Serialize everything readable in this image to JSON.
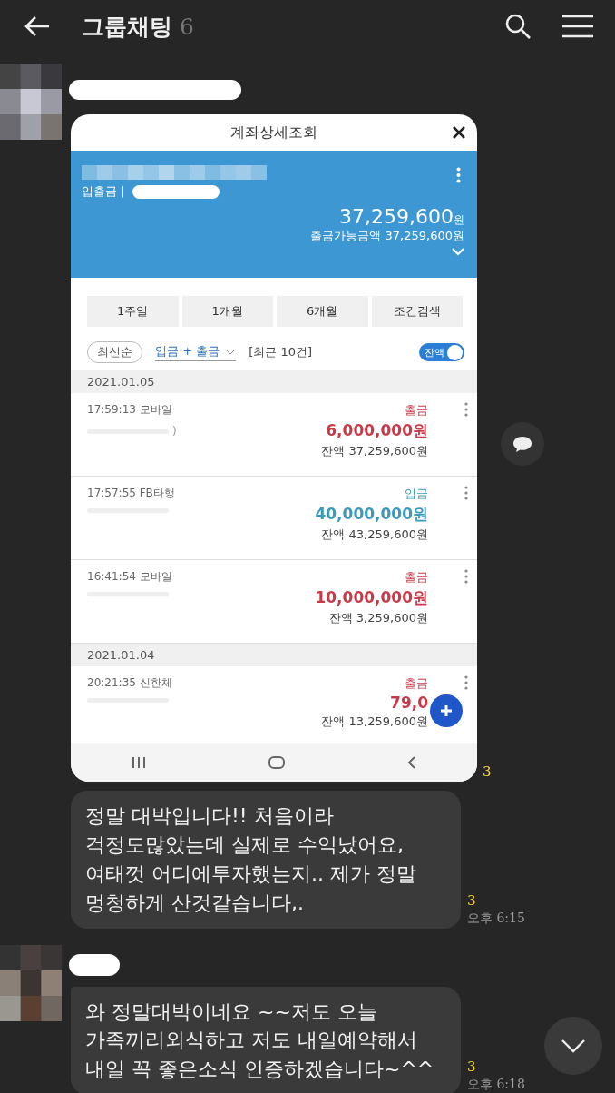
{
  "header": {
    "title": "그룹채팅",
    "member_count": "6"
  },
  "messages": [
    {
      "kind": "image",
      "read_count": "3",
      "screen": {
        "title": "계좌상세조회",
        "account_label": "입출금 |",
        "balance": "37,259,600",
        "balance_unit": "원",
        "available": "출금가능금액 37,259,600원",
        "periods": [
          {
            "label": "1주일"
          },
          {
            "label": "1개월"
          },
          {
            "label": "6개월"
          },
          {
            "label": "조건검색"
          }
        ],
        "sort": "최신순",
        "filter": "입금 + 출금",
        "recent": "[최근 10건]",
        "toggle": {
          "label": "잔액",
          "on": true
        },
        "groups": [
          {
            "date": "2021.01.05",
            "transactions": [
              {
                "time_source": "17:59:13 모바일",
                "memo": ")",
                "type": "출금",
                "kind": "withdrawal",
                "amount": "6,000,000원",
                "balance": "잔액 37,259,600원"
              },
              {
                "time_source": "17:57:55 FB타행",
                "type": "입금",
                "kind": "deposit",
                "amount": "40,000,000원",
                "balance": "잔액 43,259,600원"
              },
              {
                "time_source": "16:41:54 모바일",
                "type": "출금",
                "kind": "withdrawal",
                "amount": "10,000,000원",
                "balance": "잔액 3,259,600원"
              }
            ]
          },
          {
            "date": "2021.01.04",
            "transactions": [
              {
                "time_source": "20:21:35 신한체",
                "type": "출금",
                "kind": "withdrawal",
                "amount": "79,0",
                "balance": "잔액 13,259,600원"
              }
            ]
          }
        ]
      }
    },
    {
      "kind": "text",
      "new_sender": false,
      "text": "정말 대박입니다!! 처음이라\n걱정도많았는데 실제로 수익났어요,\n여태껏 어디에투자했는지.. 제가 정말\n멍청하게 산것같습니다,.",
      "read_count": "3",
      "time": "오후 6:15"
    },
    {
      "kind": "text",
      "new_sender": true,
      "text": "와 정말대박이네요 ~~저도 오늘\n가족끼리외식하고 저도 내일예약해서\n내일 꼭 좋은소식 인증하겠습니다~^^",
      "read_count": "3",
      "time": "오후 6:18"
    }
  ]
}
